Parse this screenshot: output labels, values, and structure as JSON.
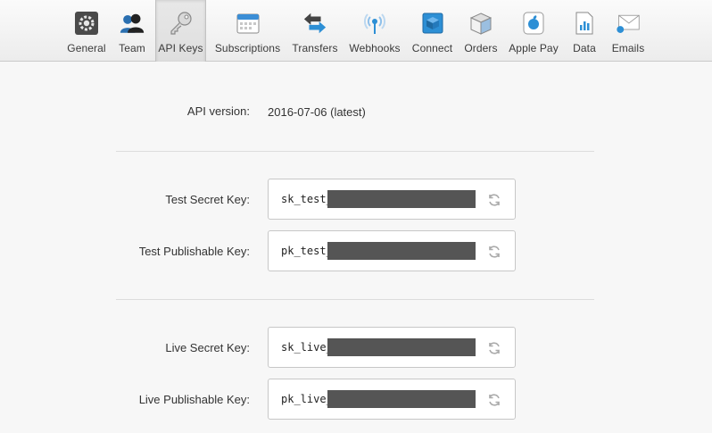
{
  "tabs": [
    {
      "label": "General",
      "icon": "gear-icon",
      "active": false
    },
    {
      "label": "Team",
      "icon": "people-icon",
      "active": false
    },
    {
      "label": "API Keys",
      "icon": "key-icon",
      "active": true
    },
    {
      "label": "Subscriptions",
      "icon": "calendar-icon",
      "active": false
    },
    {
      "label": "Transfers",
      "icon": "arrows-icon",
      "active": false
    },
    {
      "label": "Webhooks",
      "icon": "broadcast-icon",
      "active": false
    },
    {
      "label": "Connect",
      "icon": "cube-icon",
      "active": false
    },
    {
      "label": "Orders",
      "icon": "box-icon",
      "active": false
    },
    {
      "label": "Apple Pay",
      "icon": "apple-icon",
      "active": false
    },
    {
      "label": "Data",
      "icon": "chart-document-icon",
      "active": false
    },
    {
      "label": "Emails",
      "icon": "envelope-icon",
      "active": false
    }
  ],
  "api_version": {
    "label": "API version:",
    "value": "2016-07-06 (latest)"
  },
  "keys": [
    {
      "label": "Test Secret Key:",
      "prefix": "sk_test_"
    },
    {
      "label": "Test Publishable Key:",
      "prefix": "pk_test_"
    },
    {
      "label": "Live Secret Key:",
      "prefix": "sk_live_"
    },
    {
      "label": "Live Publishable Key:",
      "prefix": "pk_live_"
    }
  ],
  "colors": {
    "accent": "#2d8fd5",
    "redaction": "#555555"
  }
}
